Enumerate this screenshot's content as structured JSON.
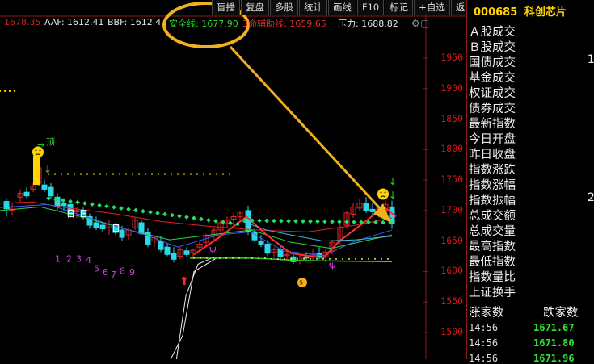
{
  "menu": [
    "盲播",
    "复盘",
    "多股",
    "统计",
    "画线",
    "F10",
    "标记",
    "+自选",
    "返回"
  ],
  "indicators": [
    {
      "text": "1678.35",
      "color": "#d02020"
    },
    {
      "text": "AAF: 1612.41",
      "color": "#e8e8e8"
    },
    {
      "text": "BBF: 1612.4",
      "color": "#e8e8e8"
    },
    {
      "text": "安全线: 1677.90",
      "color": "#2bd52b"
    },
    {
      "text": "3命辅助线: 1659.65",
      "color": "#e03030"
    },
    {
      "text": "压力: 1688.82",
      "color": "#e8e8e8"
    }
  ],
  "settings_icon": "gear-icon",
  "close_icon": "close-icon",
  "price_axis": [
    "1950",
    "1900",
    "1850",
    "1800",
    "1750",
    "1700",
    "1650",
    "1600",
    "1550",
    "1500"
  ],
  "annotations": {
    "top_label": "顶",
    "wave_numbers": [
      "1",
      "2",
      "3",
      "4",
      "5",
      "6",
      "7",
      "8",
      "9"
    ],
    "psi": "Ψ",
    "box_labels": [
      "日",
      "日",
      "日"
    ]
  },
  "stock": {
    "code": "000685",
    "name": "科创芯片"
  },
  "stats": [
    {
      "label": "Ａ股成交",
      "value": ""
    },
    {
      "label": "Ｂ股成交",
      "value": ""
    },
    {
      "label": "国债成交",
      "value": "1"
    },
    {
      "label": "基金成交",
      "value": ""
    },
    {
      "label": "权证成交",
      "value": ""
    },
    {
      "label": "债券成交",
      "value": ""
    },
    {
      "label": "最新指数",
      "value": ""
    },
    {
      "label": "今日开盘",
      "value": ""
    },
    {
      "label": "昨日收盘",
      "value": ""
    },
    {
      "label": "指数涨跌",
      "value": ""
    },
    {
      "label": "指数涨幅",
      "value": ""
    },
    {
      "label": "指数振幅",
      "value": "2"
    },
    {
      "label": "总成交额",
      "value": ""
    },
    {
      "label": "总成交量",
      "value": ""
    },
    {
      "label": "最高指数",
      "value": ""
    },
    {
      "label": "最低指数",
      "value": ""
    },
    {
      "label": "指数量比",
      "value": ""
    },
    {
      "label": "上证换手",
      "value": ""
    }
  ],
  "counts": {
    "up_label": "涨家数",
    "down_label": "跌家数"
  },
  "trades": [
    {
      "time": "14:56",
      "price": "1671.67"
    },
    {
      "time": "14:56",
      "price": "1671.80"
    },
    {
      "time": "14:56",
      "price": "1671.96"
    }
  ],
  "colors": {
    "highlight": "#f0b020",
    "up_candle": "#e02828",
    "down_candle": "#2ad8e8",
    "safety_line": "#2bd52b",
    "axis_border": "#8a1a1a"
  }
}
